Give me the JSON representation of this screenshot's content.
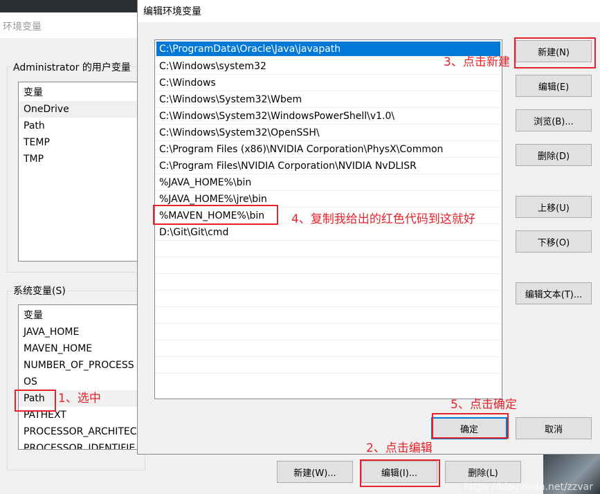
{
  "background_window": {
    "title": "环境变量",
    "user_group": "Administrator 的用户变量",
    "user_header": "变量",
    "user_vars": [
      "OneDrive",
      "Path",
      "TEMP",
      "TMP"
    ],
    "sys_group": "系统变量(S)",
    "sys_header": "变量",
    "sys_vars": [
      "JAVA_HOME",
      "MAVEN_HOME",
      "NUMBER_OF_PROCESS",
      "OS",
      "Path",
      "PATHEXT",
      "PROCESSOR_ARCHITEC",
      "PROCESSOR_IDENTIFIE"
    ],
    "buttons": {
      "new": "新建(W)...",
      "edit": "编辑(I)...",
      "delete": "删除(L)"
    }
  },
  "dialog": {
    "title": "编辑环境变量",
    "paths": [
      "C:\\ProgramData\\Oracle\\Java\\javapath",
      "C:\\Windows\\system32",
      "C:\\Windows",
      "C:\\Windows\\System32\\Wbem",
      "C:\\Windows\\System32\\WindowsPowerShell\\v1.0\\",
      "C:\\Windows\\System32\\OpenSSH\\",
      "C:\\Program Files (x86)\\NVIDIA Corporation\\PhysX\\Common",
      "C:\\Program Files\\NVIDIA Corporation\\NVIDIA NvDLISR",
      "%JAVA_HOME%\\bin",
      "%JAVA_HOME%\\jre\\bin",
      "%MAVEN_HOME%\\bin",
      "D:\\Git\\Git\\cmd"
    ],
    "buttons": {
      "new": "新建(N)",
      "edit": "编辑(E)",
      "browse": "浏览(B)...",
      "delete": "删除(D)",
      "up": "上移(U)",
      "down": "下移(O)",
      "edit_text": "编辑文本(T)...",
      "ok": "确定",
      "cancel": "取消"
    }
  },
  "annotations": {
    "a1": "1、选中",
    "a2": "2、点击编辑",
    "a3": "3、点击新建",
    "a4": "4、复制我给出的红色代码到这就好",
    "a5": "5、点击确定"
  },
  "watermark": "https://blog.csdn.net/zzvar",
  "colors": {
    "selection": "#0078d7",
    "annotation": "#e6212a"
  }
}
